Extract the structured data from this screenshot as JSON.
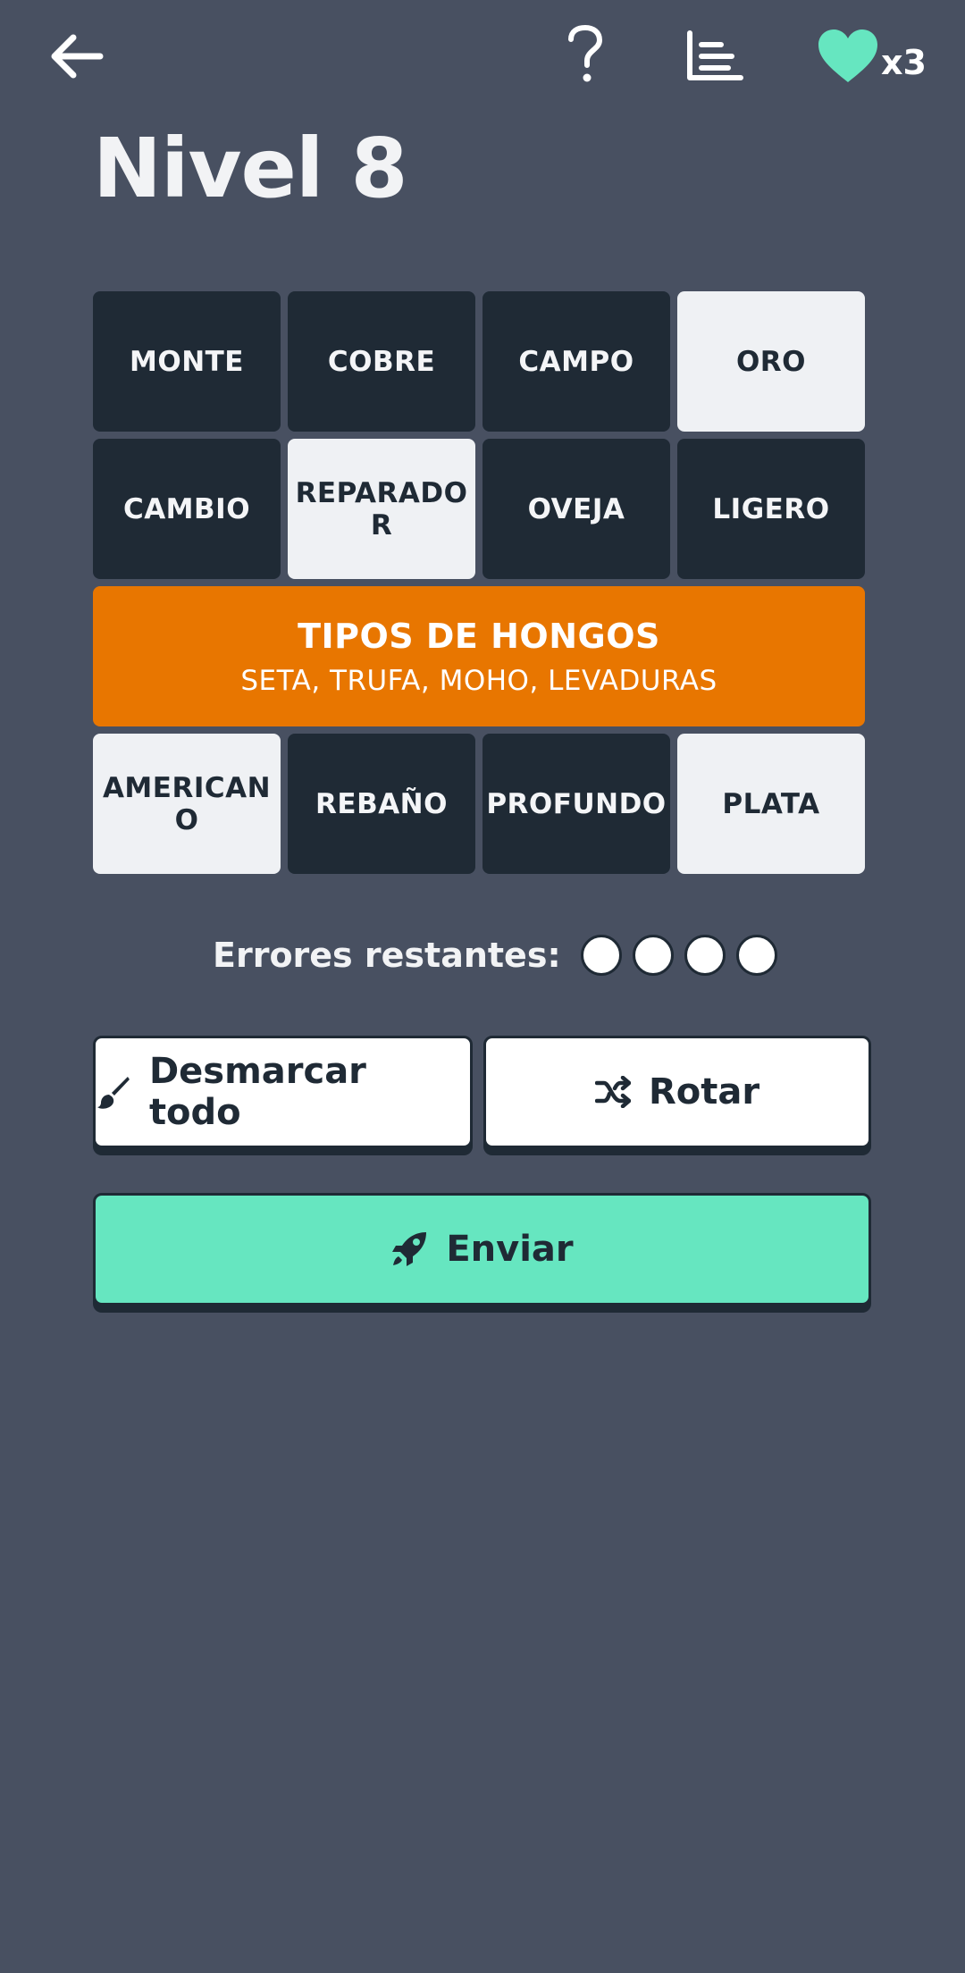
{
  "header": {
    "back_icon": "arrow-left-icon",
    "help_icon": "question-mark-icon",
    "stats_icon": "bar-chart-icon",
    "lives_icon": "heart-icon",
    "lives_count": "x3",
    "heart_color": "#66e6c0"
  },
  "title": "Nivel 8",
  "board": {
    "row1": [
      "MONTE",
      "COBRE",
      "CAMPO",
      "ORO"
    ],
    "row2": [
      "CAMBIO",
      "REPARADOR",
      "OVEJA",
      "LIGERO"
    ],
    "solved_group": {
      "title": "TIPOS DE HONGOS",
      "words": "SETA, TRUFA, MOHO, LEVADURAS",
      "color": "#e87600"
    },
    "row4": [
      "AMERICANO",
      "REBAÑO",
      "PROFUNDO",
      "PLATA"
    ],
    "selected_tiles": [
      "ORO",
      "REPARADOR",
      "AMERICANO",
      "PLATA"
    ]
  },
  "mistakes": {
    "label": "Errores restantes:",
    "remaining": 4
  },
  "actions": {
    "deselect_label": "Desmarcar todo",
    "deselect_icon": "brush-icon",
    "shuffle_label": "Rotar",
    "shuffle_icon": "shuffle-icon",
    "submit_label": "Enviar",
    "submit_icon": "rocket-icon"
  },
  "colors": {
    "background": "#485061",
    "tile_dark": "#1f2a35",
    "tile_selected": "#eff1f4",
    "submit": "#66e6c0"
  }
}
